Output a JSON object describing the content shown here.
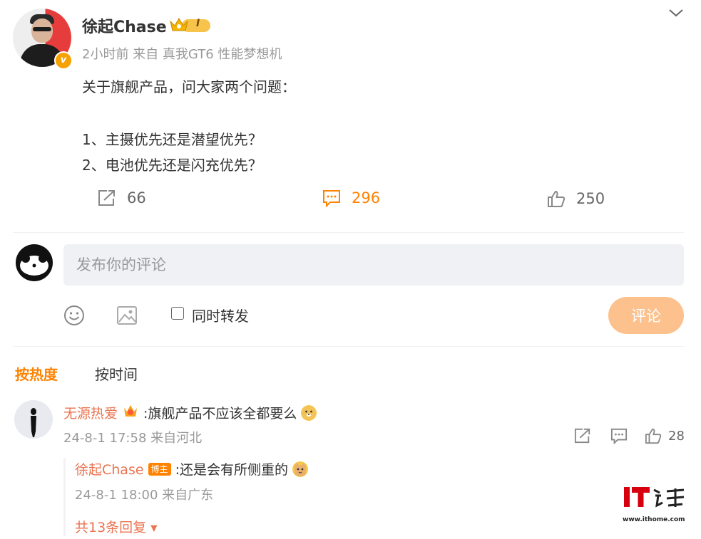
{
  "post": {
    "username": "徐起Chase",
    "level": "I",
    "meta": "2小时前 来自 真我GT6 性能梦想机",
    "lines": [
      "关于旗舰产品，问大家两个问题：",
      "",
      "1、主摄优先还是潜望优先？",
      "2、电池优先还是闪充优先？"
    ],
    "actions": {
      "repost": "66",
      "comment": "296",
      "like": "250"
    }
  },
  "composer": {
    "placeholder": "发布你的评论",
    "forward_label": "同时转发",
    "submit_label": "评论"
  },
  "sort": {
    "hot": "按热度",
    "time": "按时间"
  },
  "comments": [
    {
      "name": "无源热爱",
      "text": ":旗舰产品不应该全都要么",
      "meta": "24-8-1 17:58 来自河北",
      "like": "28",
      "reply": {
        "name": "徐起Chase",
        "badge": "博主",
        "text": ":还是会有所侧重的",
        "meta": "24-8-1 18:00 来自广东"
      },
      "more": "共13条回复"
    }
  ],
  "watermark": {
    "logo": "IT之家",
    "url": "www.ithome.com"
  },
  "colors": {
    "accent": "#ff8200",
    "name": "#eb7350",
    "muted": "#999999"
  }
}
